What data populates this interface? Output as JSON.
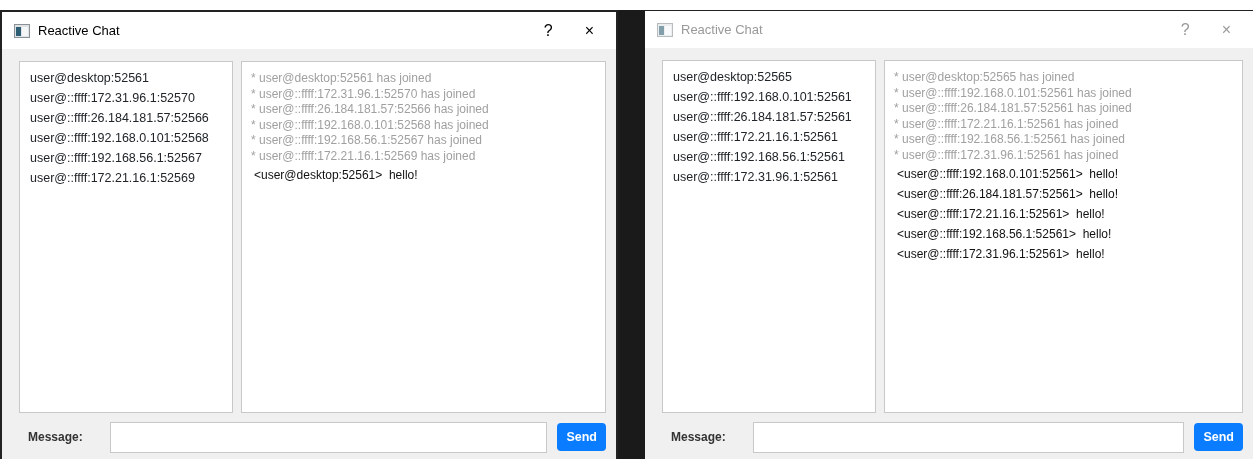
{
  "windows": [
    {
      "title": "Reactive Chat",
      "active": true,
      "help": "?",
      "close": "×",
      "users": [
        "user@desktop:52561",
        "user@::ffff:172.31.96.1:52570",
        "user@::ffff:26.184.181.57:52566",
        "user@::ffff:192.168.0.101:52568",
        "user@::ffff:192.168.56.1:52567",
        "user@::ffff:172.21.16.1:52569"
      ],
      "messages": [
        {
          "kind": "system",
          "text": "* user@desktop:52561 has joined"
        },
        {
          "kind": "system",
          "text": "* user@::ffff:172.31.96.1:52570 has joined"
        },
        {
          "kind": "system",
          "text": "* user@::ffff:26.184.181.57:52566 has joined"
        },
        {
          "kind": "system",
          "text": "* user@::ffff:192.168.0.101:52568 has joined"
        },
        {
          "kind": "system",
          "text": "* user@::ffff:192.168.56.1:52567 has joined"
        },
        {
          "kind": "system",
          "text": "* user@::ffff:172.21.16.1:52569 has joined"
        },
        {
          "kind": "chat",
          "text": "<user@desktop:52561>  hello!"
        }
      ],
      "message_label": "Message:",
      "send": "Send"
    },
    {
      "title": "Reactive Chat",
      "active": false,
      "help": "?",
      "close": "×",
      "users": [
        "user@desktop:52565",
        "user@::ffff:192.168.0.101:52561",
        "user@::ffff:26.184.181.57:52561",
        "user@::ffff:172.21.16.1:52561",
        "user@::ffff:192.168.56.1:52561",
        "user@::ffff:172.31.96.1:52561"
      ],
      "messages": [
        {
          "kind": "system",
          "text": "* user@desktop:52565 has joined"
        },
        {
          "kind": "system",
          "text": "* user@::ffff:192.168.0.101:52561 has joined"
        },
        {
          "kind": "system",
          "text": "* user@::ffff:26.184.181.57:52561 has joined"
        },
        {
          "kind": "system",
          "text": "* user@::ffff:172.21.16.1:52561 has joined"
        },
        {
          "kind": "system",
          "text": "* user@::ffff:192.168.56.1:52561 has joined"
        },
        {
          "kind": "system",
          "text": "* user@::ffff:172.31.96.1:52561 has joined"
        },
        {
          "kind": "chat",
          "text": "<user@::ffff:192.168.0.101:52561>  hello!"
        },
        {
          "kind": "chat",
          "text": "<user@::ffff:26.184.181.57:52561>  hello!"
        },
        {
          "kind": "chat",
          "text": "<user@::ffff:172.21.16.1:52561>  hello!"
        },
        {
          "kind": "chat",
          "text": "<user@::ffff:192.168.56.1:52561>  hello!"
        },
        {
          "kind": "chat",
          "text": "<user@::ffff:172.31.96.1:52561>  hello!"
        }
      ],
      "message_label": "Message:",
      "send": "Send"
    }
  ]
}
